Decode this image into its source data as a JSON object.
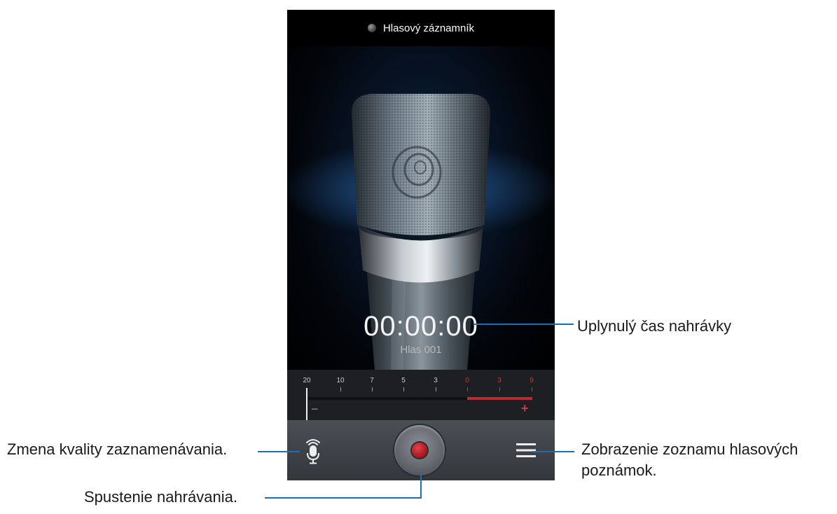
{
  "app": {
    "title": "Hlasový záznamník"
  },
  "recorder": {
    "elapsed_time": "00:00:00",
    "file_name": "Hlas 001"
  },
  "level_meter": {
    "scale": [
      {
        "label": "20",
        "zone": "normal"
      },
      {
        "label": "10",
        "zone": "normal"
      },
      {
        "label": "7",
        "zone": "normal"
      },
      {
        "label": "5",
        "zone": "normal"
      },
      {
        "label": "3",
        "zone": "normal"
      },
      {
        "label": "0",
        "zone": "red"
      },
      {
        "label": "3",
        "zone": "red"
      },
      {
        "label": "9",
        "zone": "red"
      }
    ],
    "minus_symbol": "−",
    "plus_symbol": "+",
    "current_level": 0
  },
  "toolbar": {
    "quality_icon": "microphone-signal-icon",
    "record_icon": "record-dot-icon",
    "list_icon": "menu-list-icon"
  },
  "annotations": {
    "elapsed_time": "Uplynulý čas nahrávky",
    "quality": "Zmena kvality zaznamenávania.",
    "list_line1": "Zobrazenie zoznamu hlasových",
    "list_line2": "poznámok.",
    "record": "Spustenie nahrávania."
  },
  "colors": {
    "callout_line": "#1a6fb5",
    "meter_red": "#c0272d",
    "record_red": "#c8232c"
  }
}
